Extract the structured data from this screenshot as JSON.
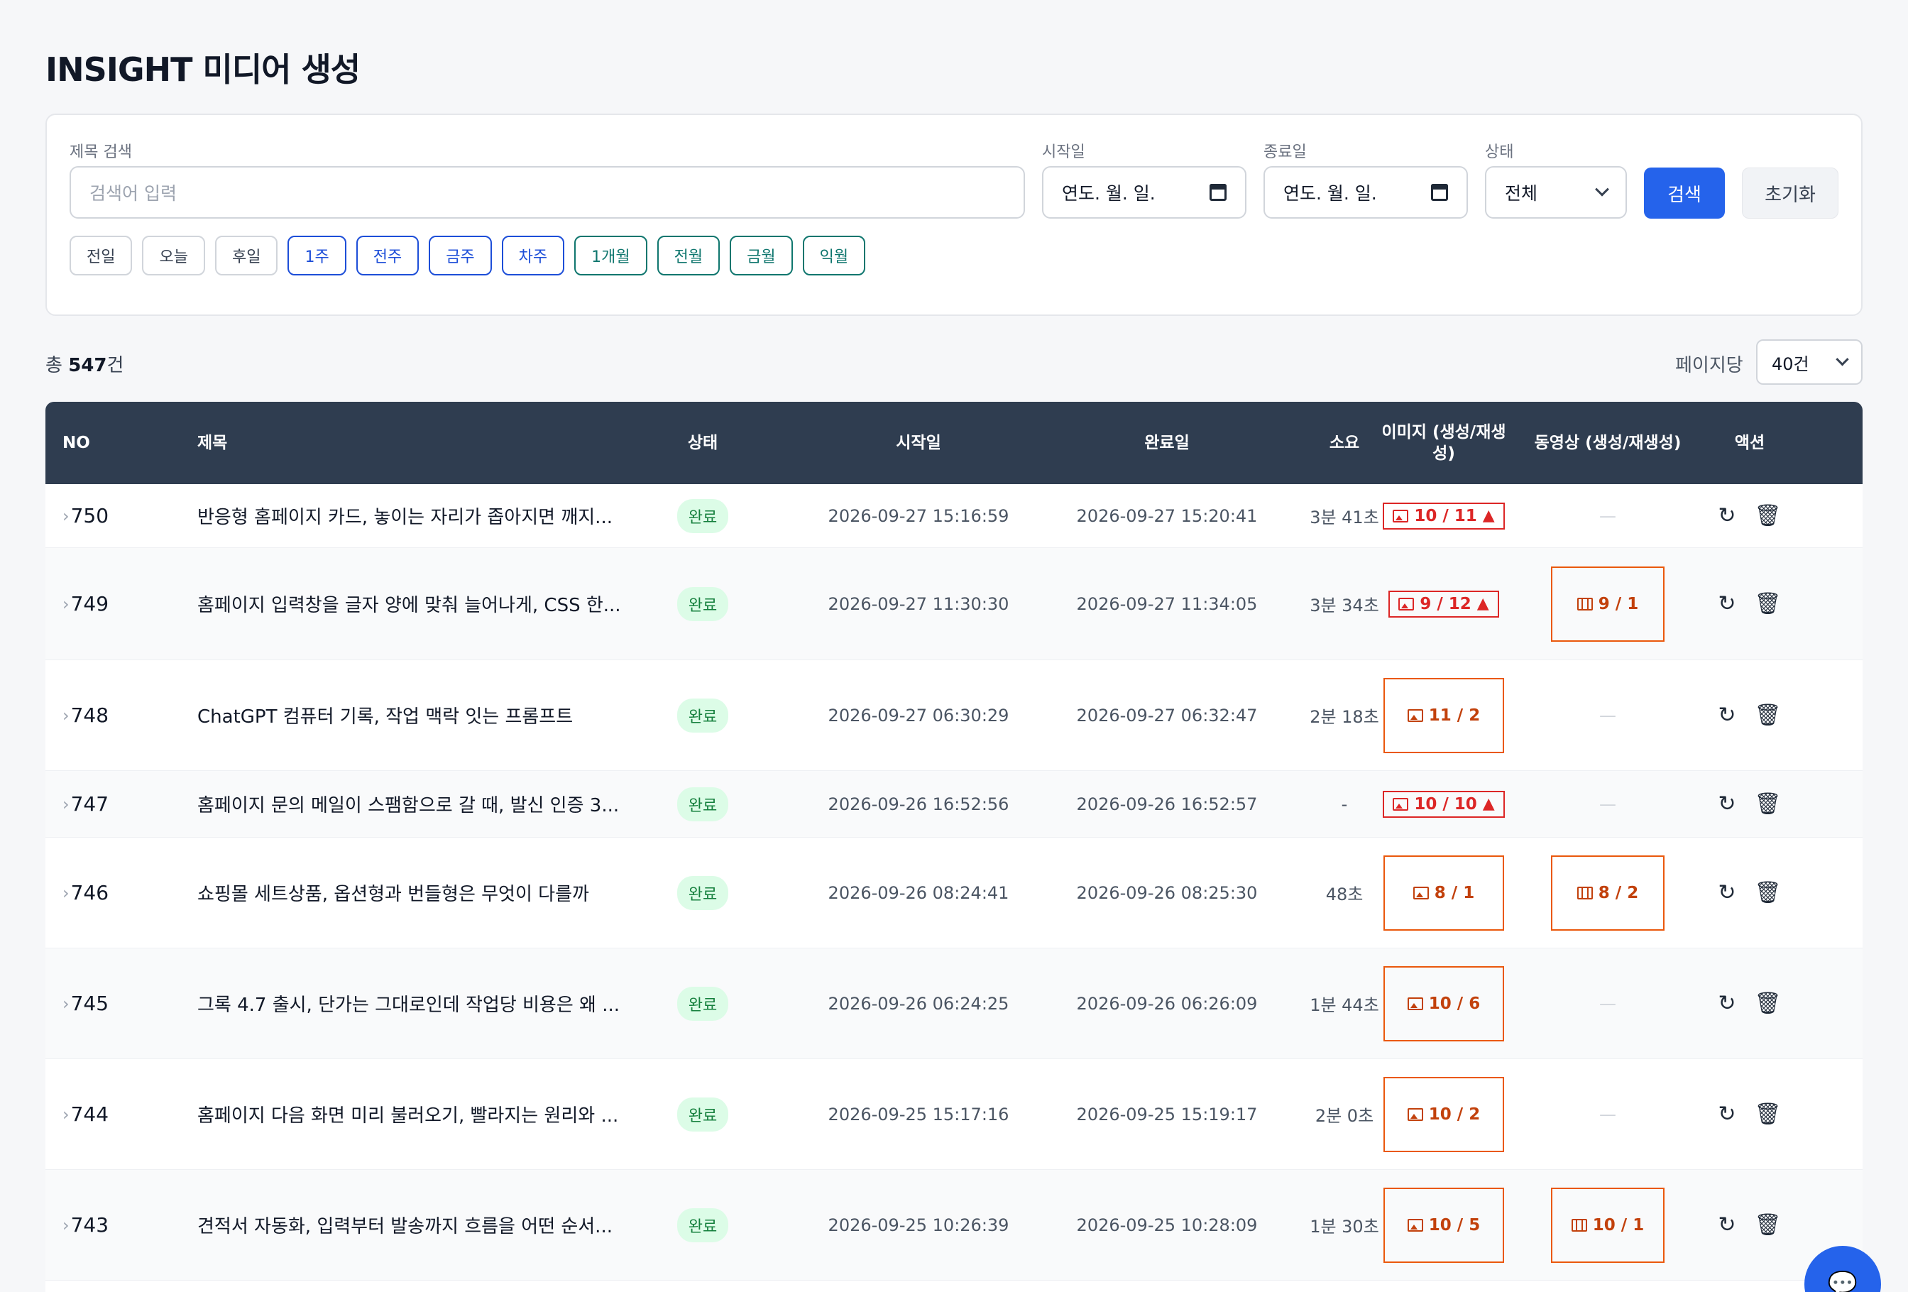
{
  "page": {
    "title": "INSIGHT 미디어 생성"
  },
  "filters": {
    "title_label": "제목 검색",
    "title_placeholder": "검색어 입력",
    "start_label": "시작일",
    "start_value": "연도. 월. 일.",
    "end_label": "종료일",
    "end_value": "연도. 월. 일.",
    "status_label": "상태",
    "status_value": "전체",
    "search_button": "검색",
    "reset_button": "초기화",
    "quick": [
      {
        "label": "전일",
        "style": "gray"
      },
      {
        "label": "오늘",
        "style": "gray"
      },
      {
        "label": "후일",
        "style": "gray"
      },
      {
        "label": "1주",
        "style": "blue"
      },
      {
        "label": "전주",
        "style": "blue"
      },
      {
        "label": "금주",
        "style": "blue"
      },
      {
        "label": "차주",
        "style": "blue"
      },
      {
        "label": "1개월",
        "style": "teal"
      },
      {
        "label": "전월",
        "style": "teal"
      },
      {
        "label": "금월",
        "style": "teal"
      },
      {
        "label": "익월",
        "style": "teal"
      }
    ]
  },
  "summary": {
    "total_prefix": "총 ",
    "total_count": "547",
    "total_suffix": "건",
    "per_page_label": "페이지당",
    "per_page_value": "40건"
  },
  "table": {
    "headers": {
      "no": "NO",
      "title": "제목",
      "status": "상태",
      "start": "시작일",
      "end": "완료일",
      "duration": "소요",
      "image": "이미지 (생성/재생성)",
      "video": "동영상 (생성/재생성)",
      "action": "액션"
    },
    "rows": [
      {
        "no": "750",
        "title": "반응형 홈페이지 카드, 놓이는 자리가 좁아지면 깨지...",
        "status": "완료",
        "start": "2026-09-27 15:16:59",
        "end": "2026-09-27 15:20:41",
        "duration": "3분 41초",
        "image": "10 / 11",
        "image_style": "red",
        "video": "—",
        "video_style": "none"
      },
      {
        "no": "749",
        "title": "홈페이지 입력창을 글자 양에 맞춰 늘어나게, CSS 한...",
        "status": "완료",
        "start": "2026-09-27 11:30:30",
        "end": "2026-09-27 11:34:05",
        "duration": "3분 34초",
        "image": "9 / 12",
        "image_style": "red",
        "video": "9 / 1",
        "video_style": "orange"
      },
      {
        "no": "748",
        "title": "ChatGPT 컴퓨터 기록, 작업 맥락 잇는 프롬프트",
        "status": "완료",
        "start": "2026-09-27 06:30:29",
        "end": "2026-09-27 06:32:47",
        "duration": "2분 18초",
        "image": "11 / 2",
        "image_style": "orange",
        "video": "—",
        "video_style": "none"
      },
      {
        "no": "747",
        "title": "홈페이지 문의 메일이 스팸함으로 갈 때, 발신 인증 3...",
        "status": "완료",
        "start": "2026-09-26 16:52:56",
        "end": "2026-09-26 16:52:57",
        "duration": "-",
        "image": "10 / 10",
        "image_style": "red",
        "video": "—",
        "video_style": "none"
      },
      {
        "no": "746",
        "title": "쇼핑몰 세트상품, 옵션형과 번들형은 무엇이 다를까",
        "status": "완료",
        "start": "2026-09-26 08:24:41",
        "end": "2026-09-26 08:25:30",
        "duration": "48초",
        "image": "8 / 1",
        "image_style": "orange",
        "video": "8 / 2",
        "video_style": "orange"
      },
      {
        "no": "745",
        "title": "그록 4.7 출시, 단가는 그대로인데 작업당 비용은 왜 ...",
        "status": "완료",
        "start": "2026-09-26 06:24:25",
        "end": "2026-09-26 06:26:09",
        "duration": "1분 44초",
        "image": "10 / 6",
        "image_style": "orange",
        "video": "—",
        "video_style": "none"
      },
      {
        "no": "744",
        "title": "홈페이지 다음 화면 미리 불러오기, 빨라지는 원리와 ...",
        "status": "완료",
        "start": "2026-09-25 15:17:16",
        "end": "2026-09-25 15:19:17",
        "duration": "2분 0초",
        "image": "10 / 2",
        "image_style": "orange",
        "video": "—",
        "video_style": "none"
      },
      {
        "no": "743",
        "title": "견적서 자동화, 입력부터 발송까지 흐름을 어떤 순서...",
        "status": "완료",
        "start": "2026-09-25 10:26:39",
        "end": "2026-09-25 10:28:09",
        "duration": "1분 30초",
        "image": "10 / 5",
        "image_style": "orange",
        "video": "10 / 1",
        "video_style": "orange"
      }
    ]
  },
  "icons": {
    "image": "image-icon",
    "video": "film-icon",
    "warning": "warning-icon",
    "refresh": "refresh-icon",
    "delete": "trash-icon",
    "chat": "chat-icon"
  },
  "colors": {
    "header_bg": "#2f3d50",
    "primary": "#2563eb",
    "status_done_bg": "#dcfce7",
    "status_done_text": "#15803d",
    "warn_red": "#dc2626",
    "regen_orange": "#ea580c"
  }
}
